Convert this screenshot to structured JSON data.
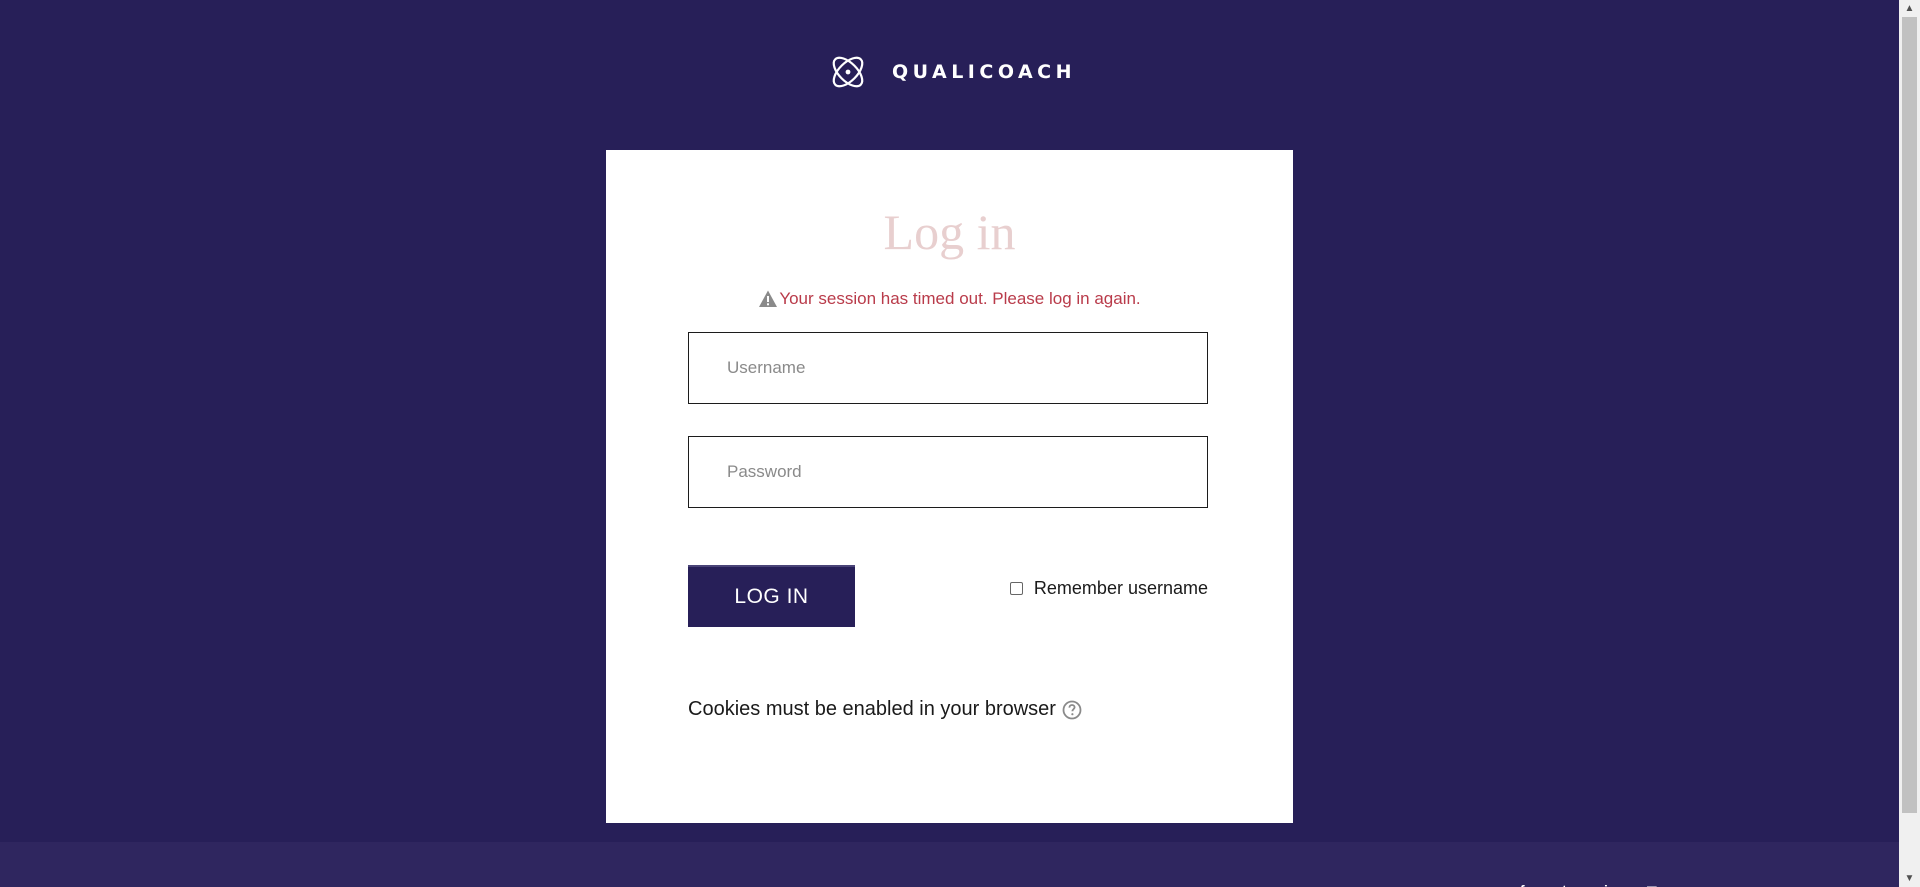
{
  "brand": {
    "name": "QUALICOACH",
    "logo_icon": "qualicoach-logo-icon"
  },
  "login": {
    "title": "Log in",
    "alert": {
      "icon": "warning-icon",
      "message": "Your session has timed out. Please log in again."
    },
    "username": {
      "value": "",
      "placeholder": "Username"
    },
    "password": {
      "value": "",
      "placeholder": "Password"
    },
    "login_button_label": "LOG IN",
    "remember": {
      "label": "Remember username",
      "checked": false
    },
    "cookies_notice": "Cookies must be enabled in your browser",
    "help_icon": "help-circle-icon"
  },
  "footer": {
    "social_icons": [
      "facebook-icon",
      "twitter-icon",
      "linkedin-icon",
      "instagram-icon"
    ]
  },
  "colors": {
    "background": "#271f58",
    "title": "#e8cfcf",
    "alert": "#b93b4a",
    "button": "#271f58"
  }
}
